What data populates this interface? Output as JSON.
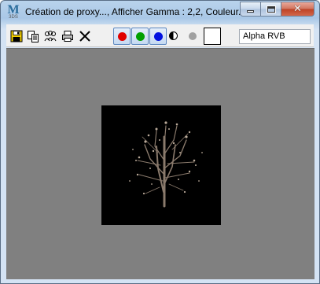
{
  "window": {
    "app_icon": {
      "letter": "M",
      "sub": "3DS"
    },
    "title": "Création de proxy..., Afficher Gamma : 2,2, Couleur...",
    "controls": {
      "minimize": "minimize-icon",
      "maximize": "maximize-icon",
      "close": "close-icon"
    }
  },
  "toolbar": {
    "icons": [
      "save-icon",
      "copy-icon",
      "clone-icon",
      "print-icon",
      "clear-icon"
    ],
    "channels": {
      "red": "#e00000",
      "green": "#00a000",
      "blue": "#0010e0"
    },
    "display_color": "#ffffff",
    "channel_select": {
      "value": "Alpha RVB"
    }
  },
  "viewport": {
    "background": "#808080",
    "preview_background": "#000000",
    "content": "tree-image"
  }
}
